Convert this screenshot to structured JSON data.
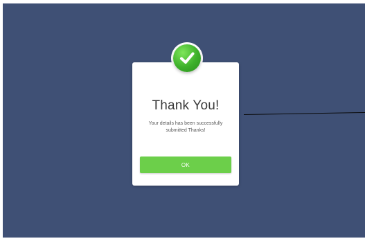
{
  "dialog": {
    "icon": "checkmark-icon",
    "title": "Thank You!",
    "message": "Your details has been successfully submitted Thanks!",
    "ok_label": "OK"
  },
  "colors": {
    "backdrop": "#3f5075",
    "success_green": "#3db02a",
    "button_green": "#6ccf4a"
  }
}
